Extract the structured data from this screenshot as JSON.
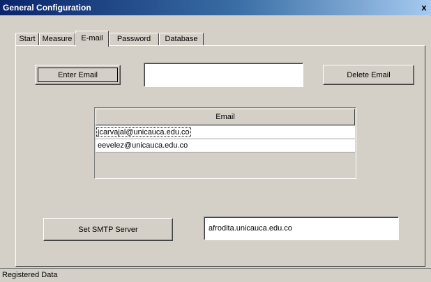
{
  "window": {
    "title": "General Configuration",
    "close_glyph": "x"
  },
  "tabs": [
    {
      "label": "Start"
    },
    {
      "label": "Measure"
    },
    {
      "label": "E-mail"
    },
    {
      "label": "Password"
    },
    {
      "label": "Database"
    }
  ],
  "active_tab": "E-mail",
  "email": {
    "enter_button": "Enter Email",
    "input_value": "",
    "delete_button": "Delete Email",
    "grid": {
      "header": "Email",
      "rows": [
        "jcarvajal@unicauca.edu.co",
        "eevelez@unicauca.edu.co"
      ]
    },
    "smtp_button": "Set SMTP Server",
    "smtp_value": "afrodita.unicauca.edu.co"
  },
  "status": {
    "text": "Registered Data"
  },
  "colors": {
    "face": "#d4d0c8",
    "title_start": "#0a246a",
    "title_end": "#a6caf0"
  }
}
